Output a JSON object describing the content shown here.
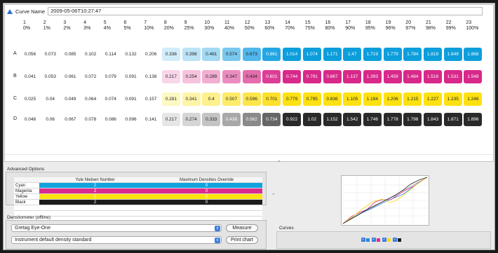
{
  "curve_name": {
    "label": "Curve Name",
    "value": "2009-05-06T10:27:47"
  },
  "columns": [
    {
      "n": "1",
      "p": "0%"
    },
    {
      "n": "2",
      "p": "1%"
    },
    {
      "n": "3",
      "p": "2%"
    },
    {
      "n": "4",
      "p": "3%"
    },
    {
      "n": "5",
      "p": "4%"
    },
    {
      "n": "6",
      "p": "5%"
    },
    {
      "n": "7",
      "p": "10%"
    },
    {
      "n": "8",
      "p": "20%"
    },
    {
      "n": "9",
      "p": "25%"
    },
    {
      "n": "10",
      "p": "30%"
    },
    {
      "n": "11",
      "p": "40%"
    },
    {
      "n": "12",
      "p": "50%"
    },
    {
      "n": "13",
      "p": "60%"
    },
    {
      "n": "14",
      "p": "70%"
    },
    {
      "n": "15",
      "p": "75%"
    },
    {
      "n": "16",
      "p": "80%"
    },
    {
      "n": "17",
      "p": "90%"
    },
    {
      "n": "18",
      "p": "95%"
    },
    {
      "n": "19",
      "p": "96%"
    },
    {
      "n": "20",
      "p": "97%"
    },
    {
      "n": "21",
      "p": "98%"
    },
    {
      "n": "22",
      "p": "99%"
    },
    {
      "n": "23",
      "p": "100%"
    }
  ],
  "rows": [
    {
      "label": "A",
      "values": [
        "0.056",
        "0.073",
        "0.085",
        "0.102",
        "0.114",
        "0.132",
        "0.206",
        "0.336",
        "0.398",
        "0.461",
        "0.574",
        "0.673",
        "0.861",
        "1.014",
        "1.074",
        "1.171",
        "1.47",
        "1.719",
        "1.779",
        "1.784",
        "1.819",
        "1.849",
        "1.868"
      ]
    },
    {
      "label": "B",
      "values": [
        "0.041",
        "0.053",
        "0.061",
        "0.072",
        "0.079",
        "0.091",
        "0.138",
        "0.217",
        "0.254",
        "0.289",
        "0.347",
        "0.434",
        "0.601",
        "0.744",
        "0.791",
        "0.867",
        "1.137",
        "1.393",
        "1.459",
        "1.484",
        "1.516",
        "1.531",
        "1.548"
      ]
    },
    {
      "label": "C",
      "values": [
        "0.025",
        "0.04",
        "0.049",
        "0.064",
        "0.074",
        "0.091",
        "0.157",
        "0.281",
        "0.341",
        "0.4",
        "0.507",
        "0.596",
        "0.701",
        "0.779",
        "0.795",
        "0.836",
        "1.105",
        "1.194",
        "1.206",
        "1.215",
        "1.227",
        "1.235",
        "1.246"
      ]
    },
    {
      "label": "D",
      "values": [
        "0.048",
        "0.06",
        "0.067",
        "0.078",
        "0.086",
        "0.096",
        "0.141",
        "0.217",
        "0.274",
        "0.333",
        "0.438",
        "0.562",
        "0.734",
        "0.922",
        "1.02",
        "1.152",
        "1.542",
        "1.746",
        "1.778",
        "1.798",
        "1.843",
        "1.871",
        "1.896"
      ]
    }
  ],
  "row_styles": [
    {
      "light": [
        "#ffffff",
        "#ffffff",
        "#ffffff",
        "#ffffff",
        "#ffffff",
        "#ffffff",
        "#ffffff",
        "#d2edf9",
        "#bce3f6",
        "#a3d9f3",
        "#79c8ef",
        "#50b7ea",
        "#23a6e3"
      ],
      "dark": "#0d9edc"
    },
    {
      "light": [
        "#ffffff",
        "#ffffff",
        "#ffffff",
        "#ffffff",
        "#ffffff",
        "#ffffff",
        "#ffffff",
        "#f9d6e9",
        "#f6c2de",
        "#f2aed2",
        "#ec8dc0",
        "#e56cad",
        "#dd3d97"
      ],
      "dark": "#d8288a"
    },
    {
      "light": [
        "#ffffff",
        "#ffffff",
        "#ffffff",
        "#ffffff",
        "#ffffff",
        "#ffffff",
        "#ffffff",
        "#fef8c2",
        "#fef4a8",
        "#fef08e",
        "#feeb6a",
        "#fde64a",
        "#fde12c"
      ],
      "dark": "#fde112"
    },
    {
      "light": [
        "#ffffff",
        "#ffffff",
        "#ffffff",
        "#ffffff",
        "#ffffff",
        "#ffffff",
        "#ffffff",
        "#e6e6e6",
        "#d6d6d6",
        "#c4c4c4",
        "#a8a8a8",
        "#8a8a8a",
        "#666666"
      ],
      "dark": "#2a2a2a"
    }
  ],
  "advanced": {
    "title": "Advanced Options",
    "col1": "Yule Nielsen Number",
    "col2": "Maximum Densities Override",
    "rows": [
      {
        "name": "Cyan",
        "yn": "2",
        "max": "0",
        "color": "#12a3de"
      },
      {
        "name": "Magenta",
        "yn": "2",
        "max": "0",
        "color": "#dc2a8e"
      },
      {
        "name": "Yellow",
        "yn": "2",
        "max": "0",
        "color": "#fde30a"
      },
      {
        "name": "Black",
        "yn": "2",
        "max": "0",
        "color": "#1c1c1c"
      }
    ]
  },
  "densitometer": {
    "title": "Densitometer (offline)",
    "device": "Gretag Eye-One",
    "standard": "Instrument default density standard",
    "measure": "Measure",
    "print": "Print chart"
  },
  "curves": {
    "title": "Curves",
    "legend": [
      "#2b8bd8",
      "#de2b8f",
      "#f2de10",
      "#1e1e1e"
    ]
  }
}
